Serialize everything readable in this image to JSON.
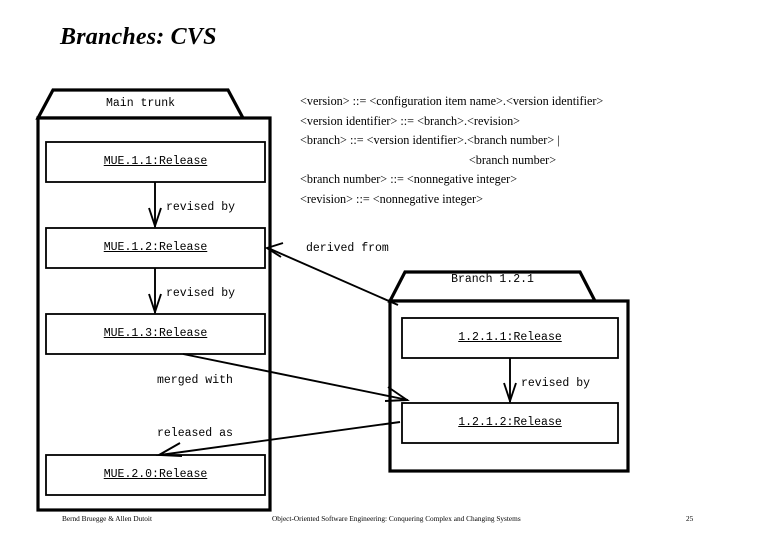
{
  "slide": {
    "title": "Branches: CVS",
    "background": "#ffffff",
    "ink": "#000000"
  },
  "grammar": {
    "lines": [
      "<version> ::= <configuration item name>.<version identifier>",
      "<version identifier> ::= <branch>.<revision>",
      "<branch> ::= <version identifier>.<branch number> |",
      "<branch number>",
      "<branch number> ::= <nonnegative integer>",
      "<revision> ::= <nonnegative integer>"
    ]
  },
  "packages": [
    {
      "name": "main-trunk",
      "title": "Main trunk",
      "releases": [
        "MUE.1.1:Release",
        "MUE.1.2:Release",
        "MUE.1.3:Release",
        "MUE.2.0:Release"
      ]
    },
    {
      "name": "branch-121",
      "title": "Branch 1.2.1",
      "releases": [
        "1.2.1.1:Release",
        "1.2.1.2:Release"
      ]
    }
  ],
  "edges": [
    {
      "name": "revised-by-1-1-to-1-2",
      "label": "revised by"
    },
    {
      "name": "revised-by-1-2-to-1-3",
      "label": "revised by"
    },
    {
      "name": "derived-from",
      "label": "derived from"
    },
    {
      "name": "merged-with",
      "label": "merged with"
    },
    {
      "name": "released-as",
      "label": "released as"
    },
    {
      "name": "revised-by-1211-to-1212",
      "label": "revised by"
    }
  ],
  "footer": {
    "authors": "Bernd Bruegge & Allen Dutoit",
    "book": "Object-Oriented Software Engineering: Conquering Complex and Changing Systems",
    "page": "25"
  }
}
